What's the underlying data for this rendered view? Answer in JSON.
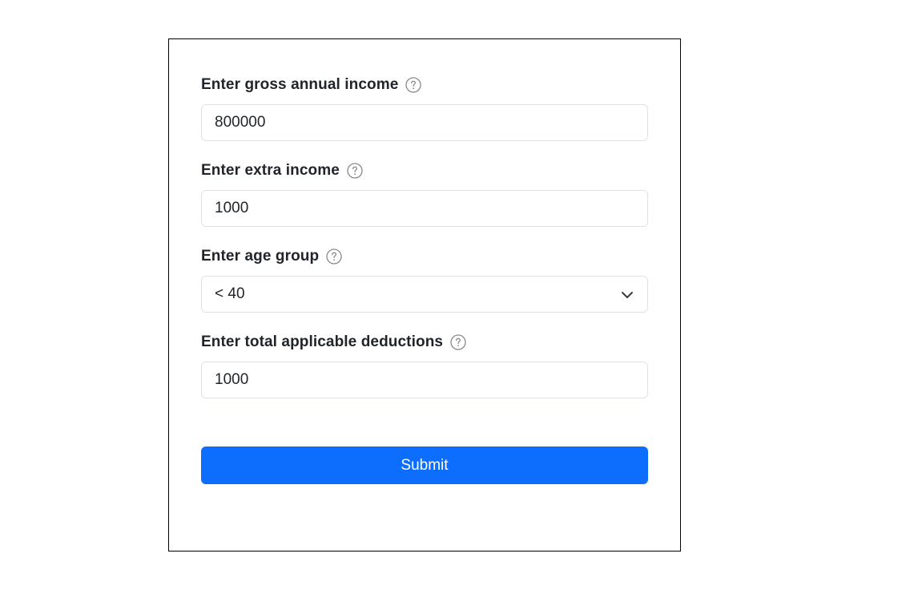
{
  "form": {
    "gross_income": {
      "label": "Enter gross annual income",
      "value": "800000",
      "help_icon": "question-circle-icon"
    },
    "extra_income": {
      "label": "Enter extra income",
      "value": "1000",
      "help_icon": "question-circle-icon"
    },
    "age_group": {
      "label": "Enter age group",
      "selected": "< 40",
      "help_icon": "question-circle-icon",
      "dropdown_icon": "chevron-down-icon"
    },
    "deductions": {
      "label": "Enter total applicable deductions",
      "value": "1000",
      "help_icon": "question-circle-icon"
    },
    "submit_label": "Submit"
  },
  "colors": {
    "primary": "#0d6efd",
    "input_border": "#dee2e6",
    "card_border": "#000000",
    "text": "#212529",
    "help_icon": "#8a8a8a"
  }
}
